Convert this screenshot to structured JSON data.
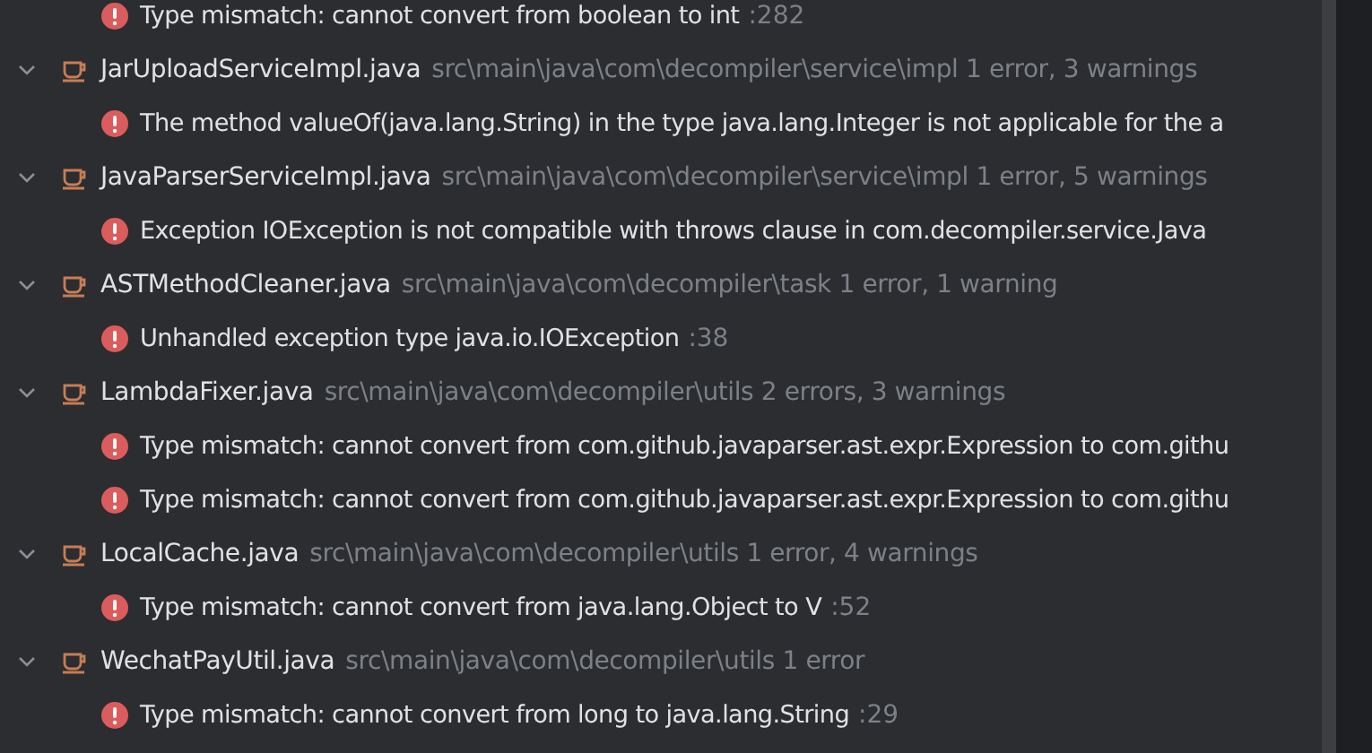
{
  "leading_problem": {
    "message": "Type mismatch: cannot convert from boolean to int",
    "line": ":282"
  },
  "groups": [
    {
      "file": "JarUploadServiceImpl.java",
      "path": "src\\main\\java\\com\\decompiler\\service\\impl",
      "summary": "1 error, 3 warnings",
      "expanded": true,
      "problems": [
        {
          "message": "The method valueOf(java.lang.String) in the type java.lang.Integer is not applicable for the a"
        }
      ]
    },
    {
      "file": "JavaParserServiceImpl.java",
      "path": "src\\main\\java\\com\\decompiler\\service\\impl",
      "summary": "1 error, 5 warnings",
      "expanded": true,
      "problems": [
        {
          "message": "Exception IOException is not compatible with throws clause in com.decompiler.service.Java"
        }
      ]
    },
    {
      "file": "ASTMethodCleaner.java",
      "path": "src\\main\\java\\com\\decompiler\\task",
      "summary": "1 error, 1 warning",
      "expanded": true,
      "problems": [
        {
          "message": "Unhandled exception type java.io.IOException",
          "line": ":38"
        }
      ]
    },
    {
      "file": "LambdaFixer.java",
      "path": "src\\main\\java\\com\\decompiler\\utils",
      "summary": "2 errors, 3 warnings",
      "expanded": true,
      "problems": [
        {
          "message": "Type mismatch: cannot convert from com.github.javaparser.ast.expr.Expression to com.githu"
        },
        {
          "message": "Type mismatch: cannot convert from com.github.javaparser.ast.expr.Expression to com.githu"
        }
      ]
    },
    {
      "file": "LocalCache.java",
      "path": "src\\main\\java\\com\\decompiler\\utils",
      "summary": "1 error, 4 warnings",
      "expanded": true,
      "problems": [
        {
          "message": "Type mismatch: cannot convert from java.lang.Object to V",
          "line": ":52"
        }
      ]
    },
    {
      "file": "WechatPayUtil.java",
      "path": "src\\main\\java\\com\\decompiler\\utils",
      "summary": "1 error",
      "expanded": true,
      "problems": [
        {
          "message": "Type mismatch: cannot convert from long to java.lang.String",
          "line": ":29"
        }
      ]
    }
  ]
}
